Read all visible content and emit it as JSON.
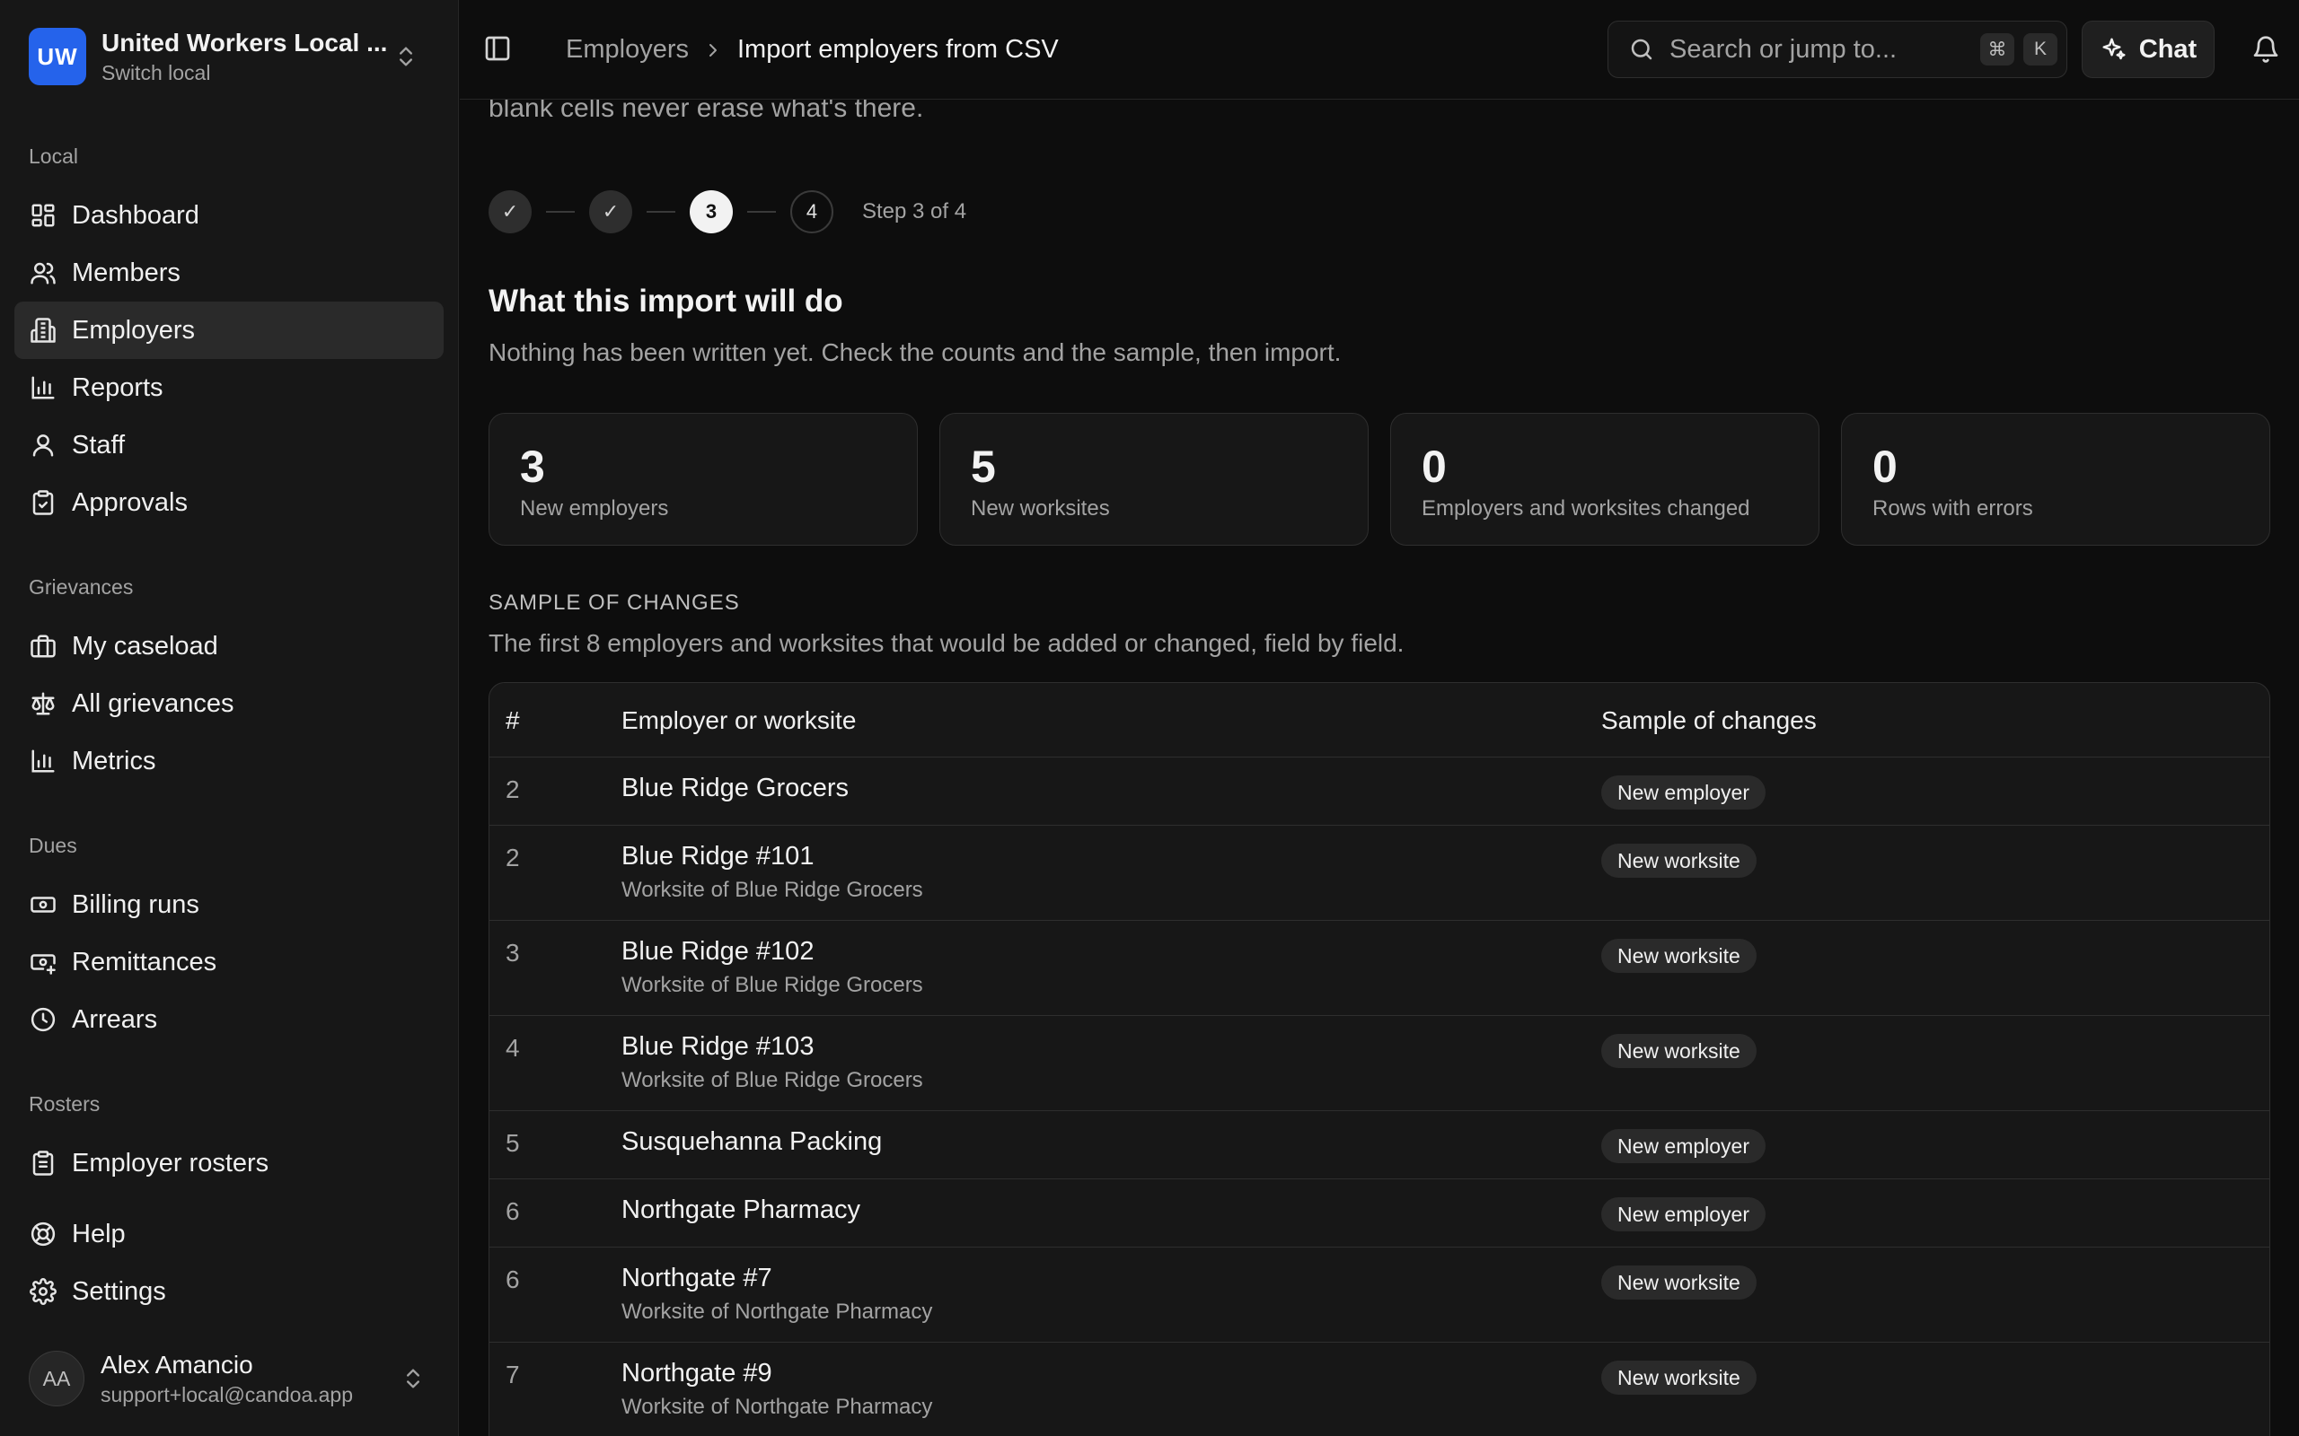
{
  "org": {
    "initials": "UW",
    "name": "United Workers Local ...",
    "subtitle": "Switch local",
    "brand_color": "#2563eb"
  },
  "sidebar": {
    "groups": [
      {
        "label": "Local",
        "items": [
          {
            "label": "Dashboard",
            "icon": "dashboard-icon"
          },
          {
            "label": "Members",
            "icon": "users-icon"
          },
          {
            "label": "Employers",
            "icon": "building-icon",
            "active": true
          },
          {
            "label": "Reports",
            "icon": "bar-chart-icon"
          },
          {
            "label": "Staff",
            "icon": "user-icon"
          },
          {
            "label": "Approvals",
            "icon": "clipboard-check-icon"
          }
        ]
      },
      {
        "label": "Grievances",
        "items": [
          {
            "label": "My caseload",
            "icon": "briefcase-icon"
          },
          {
            "label": "All grievances",
            "icon": "scale-icon"
          },
          {
            "label": "Metrics",
            "icon": "bar-chart-icon"
          }
        ]
      },
      {
        "label": "Dues",
        "items": [
          {
            "label": "Billing runs",
            "icon": "banknote-icon"
          },
          {
            "label": "Remittances",
            "icon": "banknote-arrow-icon"
          },
          {
            "label": "Arrears",
            "icon": "clock-icon"
          }
        ]
      },
      {
        "label": "Rosters",
        "items": [
          {
            "label": "Employer rosters",
            "icon": "clipboard-list-icon"
          }
        ]
      }
    ],
    "footer_items": [
      {
        "label": "Help",
        "icon": "lifebuoy-icon"
      },
      {
        "label": "Settings",
        "icon": "gear-icon"
      }
    ],
    "user": {
      "initials": "AA",
      "name": "Alex Amancio",
      "email": "support+local@candoa.app"
    }
  },
  "topbar": {
    "breadcrumb_parent": "Employers",
    "breadcrumb_current": "Import employers from CSV",
    "search_placeholder": "Search or jump to...",
    "search_kbd_1": "⌘",
    "search_kbd_2": "K",
    "chat_label": "Chat"
  },
  "wizard": {
    "intro_tail": "blank cells never erase what's there.",
    "steps": [
      {
        "label": "✓",
        "state": "done"
      },
      {
        "label": "✓",
        "state": "done"
      },
      {
        "label": "3",
        "state": "current"
      },
      {
        "label": "4",
        "state": "todo"
      }
    ],
    "step_text": "Step 3 of 4"
  },
  "summary": {
    "title": "What this import will do",
    "description": "Nothing has been written yet. Check the counts and the sample, then import.",
    "stats": [
      {
        "value": "3",
        "label": "New employers"
      },
      {
        "value": "5",
        "label": "New worksites"
      },
      {
        "value": "0",
        "label": "Employers and worksites changed"
      },
      {
        "value": "0",
        "label": "Rows with errors"
      }
    ]
  },
  "sample": {
    "heading": "SAMPLE OF CHANGES",
    "description": "The first 8 employers and worksites that would be added or changed, field by field.",
    "columns": [
      "#",
      "Employer or worksite",
      "Sample of changes"
    ],
    "rows": [
      {
        "num": "2",
        "name": "Blue Ridge Grocers",
        "sub": "",
        "change": "New employer"
      },
      {
        "num": "2",
        "name": "Blue Ridge #101",
        "sub": "Worksite of Blue Ridge Grocers",
        "change": "New worksite"
      },
      {
        "num": "3",
        "name": "Blue Ridge #102",
        "sub": "Worksite of Blue Ridge Grocers",
        "change": "New worksite"
      },
      {
        "num": "4",
        "name": "Blue Ridge #103",
        "sub": "Worksite of Blue Ridge Grocers",
        "change": "New worksite"
      },
      {
        "num": "5",
        "name": "Susquehanna Packing",
        "sub": "",
        "change": "New employer"
      },
      {
        "num": "6",
        "name": "Northgate Pharmacy",
        "sub": "",
        "change": "New employer"
      },
      {
        "num": "6",
        "name": "Northgate #7",
        "sub": "Worksite of Northgate Pharmacy",
        "change": "New worksite"
      },
      {
        "num": "7",
        "name": "Northgate #9",
        "sub": "Worksite of Northgate Pharmacy",
        "change": "New worksite"
      }
    ]
  }
}
